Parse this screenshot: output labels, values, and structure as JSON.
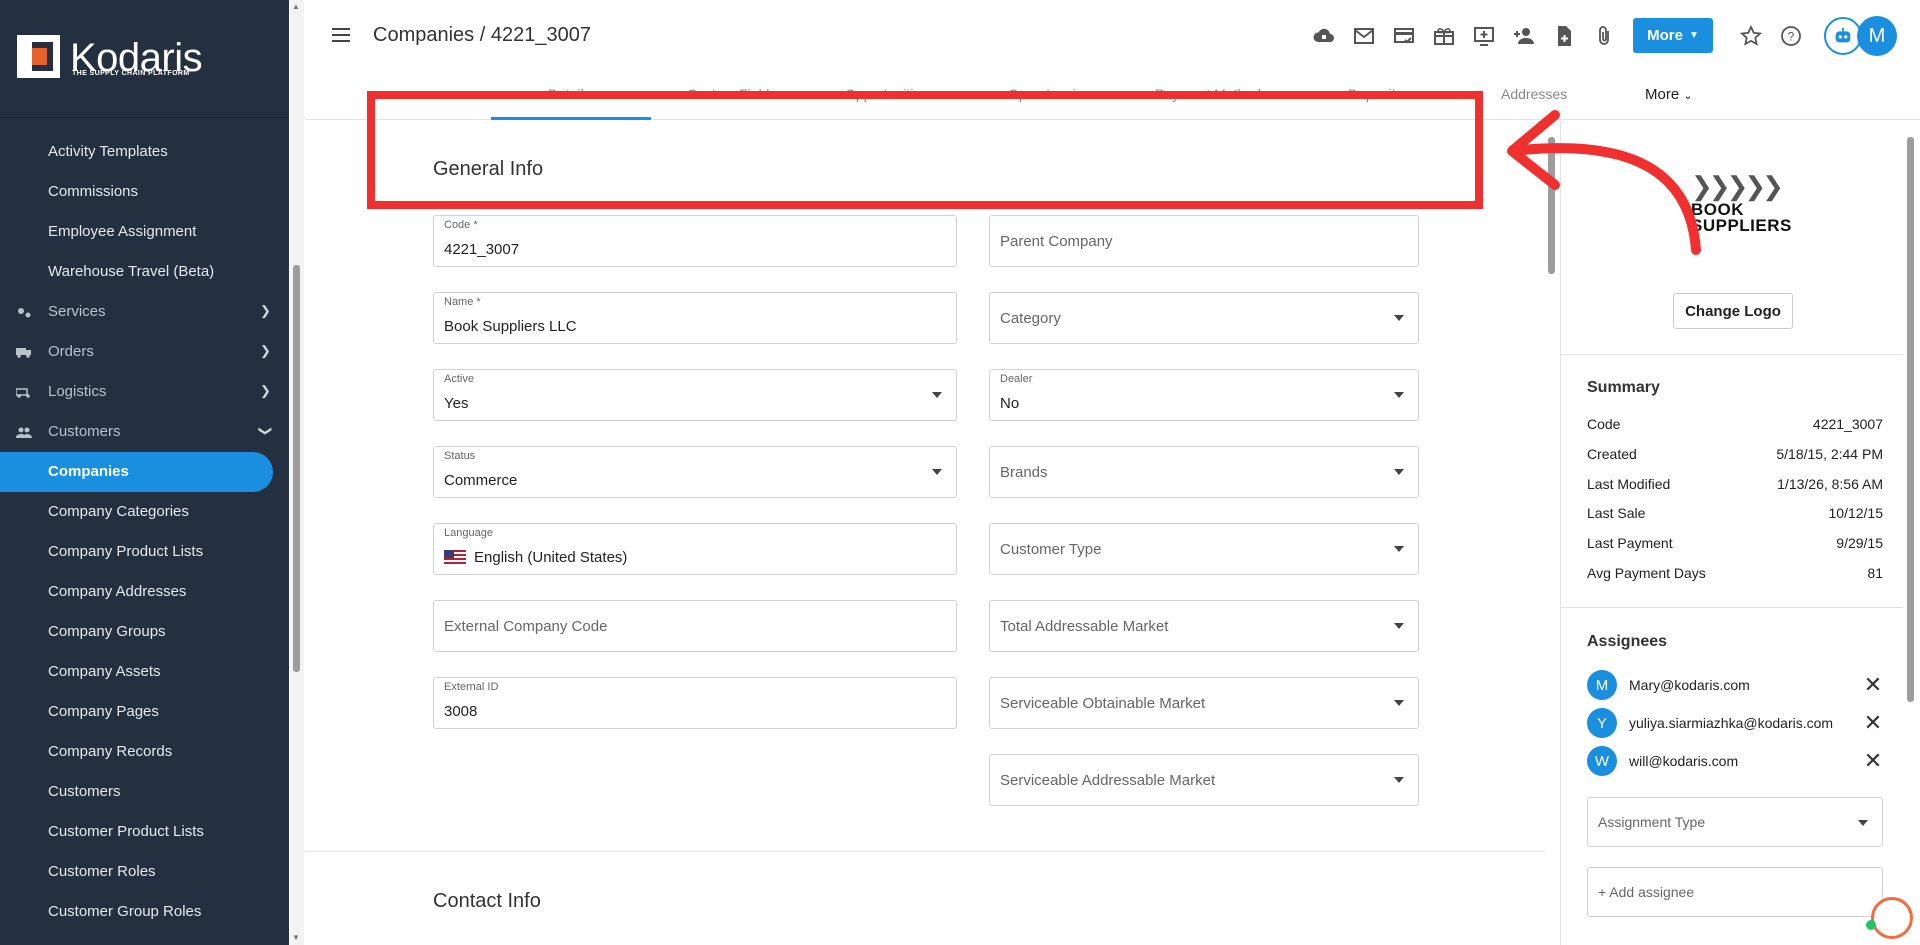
{
  "brand": {
    "name": "Kodaris",
    "tagline": "THE SUPPLY CHAIN PLATFORM"
  },
  "sidebar": {
    "items": [
      {
        "label": "Activity Templates",
        "type": "sub"
      },
      {
        "label": "Commissions",
        "type": "sub"
      },
      {
        "label": "Employee Assignment",
        "type": "sub"
      },
      {
        "label": "Warehouse Travel (Beta)",
        "type": "sub"
      },
      {
        "label": "Services",
        "type": "group",
        "icon": "services-icon"
      },
      {
        "label": "Orders",
        "type": "group",
        "icon": "truck-icon"
      },
      {
        "label": "Logistics",
        "type": "group",
        "icon": "logistics-icon"
      },
      {
        "label": "Customers",
        "type": "group-open",
        "icon": "people-icon"
      },
      {
        "label": "Companies",
        "type": "active"
      },
      {
        "label": "Company Categories",
        "type": "sub"
      },
      {
        "label": "Company Product Lists",
        "type": "sub"
      },
      {
        "label": "Company Addresses",
        "type": "sub"
      },
      {
        "label": "Company Groups",
        "type": "sub"
      },
      {
        "label": "Company Assets",
        "type": "sub"
      },
      {
        "label": "Company Pages",
        "type": "sub"
      },
      {
        "label": "Company Records",
        "type": "sub"
      },
      {
        "label": "Customers",
        "type": "sub"
      },
      {
        "label": "Customer Product Lists",
        "type": "sub"
      },
      {
        "label": "Customer Roles",
        "type": "sub"
      },
      {
        "label": "Customer Group Roles",
        "type": "sub"
      }
    ]
  },
  "header": {
    "title": "Companies / 4221_3007",
    "more_label": "More",
    "user_initial": "M",
    "icons": [
      "cloud-lock-icon",
      "mail-icon",
      "card-check-icon",
      "gift-icon",
      "screen-add-icon",
      "person-add-icon",
      "file-add-icon",
      "paperclip-icon",
      "star-icon",
      "help-icon"
    ]
  },
  "tabs": {
    "items": [
      "Details",
      "Custom Fields",
      "Opportunities",
      "Open Invoices",
      "Payment Methods",
      "Deposit",
      "Addresses"
    ],
    "more_label": "More"
  },
  "general_info": {
    "title": "General Info",
    "left_fields": [
      {
        "label": "Code *",
        "value": "4221_3007",
        "dropdown": false
      },
      {
        "label": "Name *",
        "value": "Book Suppliers LLC",
        "dropdown": false
      },
      {
        "label": "Active",
        "value": "Yes",
        "dropdown": true
      },
      {
        "label": "Status",
        "value": "Commerce",
        "dropdown": true
      },
      {
        "label": "Language",
        "value": "English (United States)",
        "dropdown": false,
        "flag": true
      },
      {
        "label": "",
        "placeholder": "External Company Code",
        "dropdown": false
      },
      {
        "label": "External ID",
        "value": "3008",
        "dropdown": false
      }
    ],
    "right_fields": [
      {
        "label": "",
        "placeholder": "Parent Company",
        "dropdown": false
      },
      {
        "label": "",
        "placeholder": "Category",
        "dropdown": true
      },
      {
        "label": "Dealer",
        "value": "No",
        "dropdown": true
      },
      {
        "label": "",
        "placeholder": "Brands",
        "dropdown": true
      },
      {
        "label": "",
        "placeholder": "Customer Type",
        "dropdown": true
      },
      {
        "label": "",
        "placeholder": "Total Addressable Market",
        "dropdown": true
      },
      {
        "label": "",
        "placeholder": "Serviceable Obtainable Market",
        "dropdown": true
      },
      {
        "label": "",
        "placeholder": "Serviceable Addressable Market",
        "dropdown": true
      }
    ]
  },
  "contact_info": {
    "title": "Contact Info"
  },
  "right_panel": {
    "logo_line1": "BOOK",
    "logo_line2": "SUPPLIERS",
    "change_logo_label": "Change Logo",
    "summary_title": "Summary",
    "summary": [
      {
        "key": "Code",
        "value": "4221_3007"
      },
      {
        "key": "Created",
        "value": "5/18/15, 2:44 PM"
      },
      {
        "key": "Last Modified",
        "value": "1/13/26, 8:56 AM"
      },
      {
        "key": "Last Sale",
        "value": "10/12/15"
      },
      {
        "key": "Last Payment",
        "value": "9/29/15"
      },
      {
        "key": "Avg Payment Days",
        "value": "81"
      }
    ],
    "assignees_title": "Assignees",
    "assignees": [
      {
        "initial": "M",
        "email": "Mary@kodaris.com"
      },
      {
        "initial": "Y",
        "email": "yuliya.siarmiazhka@kodaris.com"
      },
      {
        "initial": "W",
        "email": "will@kodaris.com"
      }
    ],
    "assignment_type_placeholder": "Assignment Type",
    "add_assignee_placeholder": "+ Add assignee"
  },
  "colors": {
    "accent": "#1a8fe0",
    "sidebar": "#243040",
    "highlight": "#f0302f"
  }
}
